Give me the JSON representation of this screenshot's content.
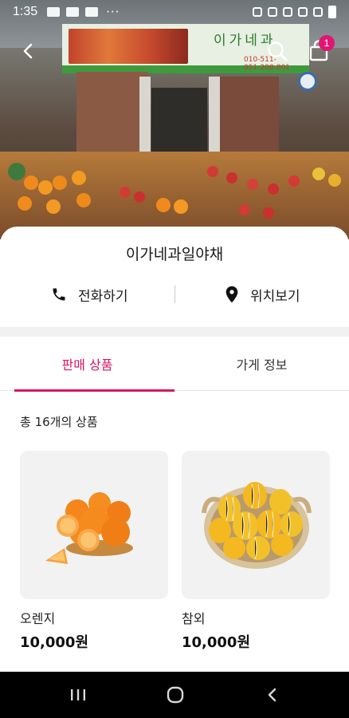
{
  "status_bar": {
    "time": "1:35",
    "overflow": "···"
  },
  "banner_sign": {
    "text": "이가네과",
    "phone_lines": [
      "010-511-",
      "051-208-801"
    ]
  },
  "header": {
    "cart_badge": "1"
  },
  "store": {
    "name": "이가네과일야채",
    "call_label": "전화하기",
    "map_label": "위치보기"
  },
  "tabs": [
    {
      "label": "판매 상품",
      "active": true
    },
    {
      "label": "가게 정보",
      "active": false
    }
  ],
  "product_count": "총 16개의 상품",
  "products": [
    {
      "name": "오렌지",
      "price": "10,000원"
    },
    {
      "name": "참외",
      "price": "10,000원"
    }
  ],
  "colors": {
    "accent": "#d8155f",
    "badge": "#e01673",
    "navbar": "#000000"
  },
  "icons": [
    "back-arrow-icon",
    "search-icon",
    "shopping-bag-icon",
    "phone-icon",
    "location-pin-icon",
    "recent-apps-icon",
    "home-icon",
    "back-icon"
  ]
}
